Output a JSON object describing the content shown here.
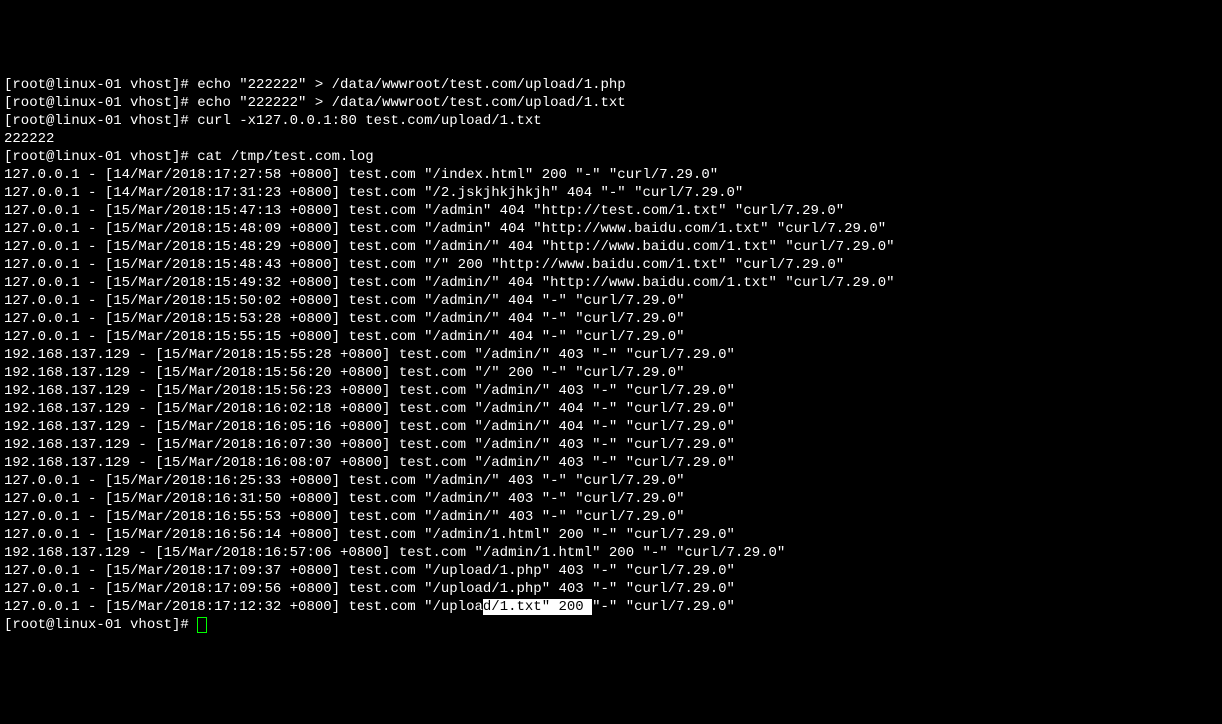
{
  "prompt": "[root@linux-01 vhost]# ",
  "commands": {
    "c1": "echo \"222222\" > /data/wwwroot/test.com/upload/1.php",
    "c2": "echo \"222222\" > /data/wwwroot/test.com/upload/1.txt",
    "c3": "curl -x127.0.0.1:80 test.com/upload/1.txt",
    "c4": "cat /tmp/test.com.log",
    "empty": ""
  },
  "output": {
    "curl_result": "222222"
  },
  "log": {
    "l0": "127.0.0.1 - [14/Mar/2018:17:27:58 +0800] test.com \"/index.html\" 200 \"-\" \"curl/7.29.0\"",
    "l1": "127.0.0.1 - [14/Mar/2018:17:31:23 +0800] test.com \"/2.jskjhkjhkjh\" 404 \"-\" \"curl/7.29.0\"",
    "l2": "127.0.0.1 - [15/Mar/2018:15:47:13 +0800] test.com \"/admin\" 404 \"http://test.com/1.txt\" \"curl/7.29.0\"",
    "l3": "127.0.0.1 - [15/Mar/2018:15:48:09 +0800] test.com \"/admin\" 404 \"http://www.baidu.com/1.txt\" \"curl/7.29.0\"",
    "l4": "127.0.0.1 - [15/Mar/2018:15:48:29 +0800] test.com \"/admin/\" 404 \"http://www.baidu.com/1.txt\" \"curl/7.29.0\"",
    "l5": "127.0.0.1 - [15/Mar/2018:15:48:43 +0800] test.com \"/\" 200 \"http://www.baidu.com/1.txt\" \"curl/7.29.0\"",
    "l6": "127.0.0.1 - [15/Mar/2018:15:49:32 +0800] test.com \"/admin/\" 404 \"http://www.baidu.com/1.txt\" \"curl/7.29.0\"",
    "l7": "127.0.0.1 - [15/Mar/2018:15:50:02 +0800] test.com \"/admin/\" 404 \"-\" \"curl/7.29.0\"",
    "l8": "127.0.0.1 - [15/Mar/2018:15:53:28 +0800] test.com \"/admin/\" 404 \"-\" \"curl/7.29.0\"",
    "l9": "127.0.0.1 - [15/Mar/2018:15:55:15 +0800] test.com \"/admin/\" 404 \"-\" \"curl/7.29.0\"",
    "l10": "192.168.137.129 - [15/Mar/2018:15:55:28 +0800] test.com \"/admin/\" 403 \"-\" \"curl/7.29.0\"",
    "l11": "192.168.137.129 - [15/Mar/2018:15:56:20 +0800] test.com \"/\" 200 \"-\" \"curl/7.29.0\"",
    "l12": "192.168.137.129 - [15/Mar/2018:15:56:23 +0800] test.com \"/admin/\" 403 \"-\" \"curl/7.29.0\"",
    "l13": "192.168.137.129 - [15/Mar/2018:16:02:18 +0800] test.com \"/admin/\" 404 \"-\" \"curl/7.29.0\"",
    "l14": "192.168.137.129 - [15/Mar/2018:16:05:16 +0800] test.com \"/admin/\" 404 \"-\" \"curl/7.29.0\"",
    "l15": "192.168.137.129 - [15/Mar/2018:16:07:30 +0800] test.com \"/admin/\" 403 \"-\" \"curl/7.29.0\"",
    "l16": "192.168.137.129 - [15/Mar/2018:16:08:07 +0800] test.com \"/admin/\" 403 \"-\" \"curl/7.29.0\"",
    "l17": "127.0.0.1 - [15/Mar/2018:16:25:33 +0800] test.com \"/admin/\" 403 \"-\" \"curl/7.29.0\"",
    "l18": "127.0.0.1 - [15/Mar/2018:16:31:50 +0800] test.com \"/admin/\" 403 \"-\" \"curl/7.29.0\"",
    "l19": "127.0.0.1 - [15/Mar/2018:16:55:53 +0800] test.com \"/admin/\" 403 \"-\" \"curl/7.29.0\"",
    "l20": "127.0.0.1 - [15/Mar/2018:16:56:14 +0800] test.com \"/admin/1.html\" 200 \"-\" \"curl/7.29.0\"",
    "l21": "192.168.137.129 - [15/Mar/2018:16:57:06 +0800] test.com \"/admin/1.html\" 200 \"-\" \"curl/7.29.0\"",
    "l22": "127.0.0.1 - [15/Mar/2018:17:09:37 +0800] test.com \"/upload/1.php\" 403 \"-\" \"curl/7.29.0\"",
    "l23": "127.0.0.1 - [15/Mar/2018:17:09:56 +0800] test.com \"/upload/1.php\" 403 \"-\" \"curl/7.29.0\"",
    "lastline": {
      "before": "127.0.0.1 - [15/Mar/2018:17:12:32 +0800] test.com \"/uploa",
      "highlight": "d/1.txt\" 200 ",
      "after": "\"-\" \"curl/7.29.0\""
    }
  }
}
